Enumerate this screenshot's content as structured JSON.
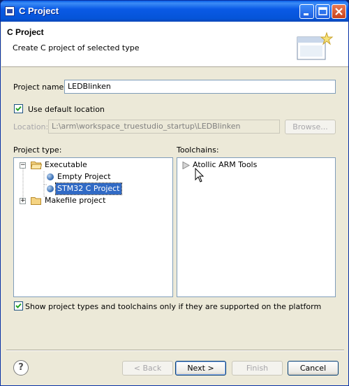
{
  "window": {
    "title": "C Project"
  },
  "header": {
    "title": "C Project",
    "description": "Create C project of selected type"
  },
  "project_name": {
    "label": "Project name:",
    "value": "LEDBlinken"
  },
  "use_default_location": {
    "label": "Use default location",
    "checked": true
  },
  "location": {
    "label": "Location:",
    "value": "L:\\arm\\workspace_truestudio_startup\\LEDBlinken",
    "browse_label": "Browse..."
  },
  "project_type": {
    "label": "Project type:",
    "items": [
      {
        "label": "Executable"
      },
      {
        "label": "Empty Project"
      },
      {
        "label": "STM32 C Project"
      },
      {
        "label": "Makefile project"
      }
    ]
  },
  "toolchains": {
    "label": "Toolchains:",
    "items": [
      {
        "label": "Atollic ARM Tools"
      }
    ]
  },
  "show_supported": {
    "label": "Show project types and toolchains only if they are supported on the platform",
    "checked": true
  },
  "buttons": {
    "back": "< Back",
    "next": "Next >",
    "finish": "Finish",
    "cancel": "Cancel",
    "help": "?"
  }
}
